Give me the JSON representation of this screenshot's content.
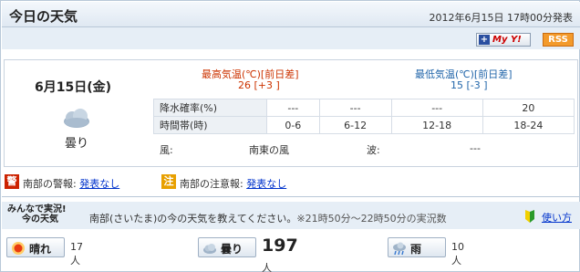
{
  "header": {
    "title": "今日の天気",
    "announced": "2012年6月15日 17時00分発表"
  },
  "toolbar": {
    "my_yahoo_plus": "+",
    "my_yahoo_label": "My Y!",
    "rss_label": "RSS"
  },
  "forecast": {
    "date": "6月15日(金)",
    "condition": "曇り",
    "icon": "cloud-icon",
    "high_label": "最高気温(℃)[前日差]",
    "high_value": "26 [+3 ]",
    "low_label": "最低気温(℃)[前日差]",
    "low_value": "15 [-3 ]",
    "precip_label": "降水確率(%)",
    "precip_values": [
      "---",
      "---",
      "---",
      "20"
    ],
    "period_label": "時間帯(時)",
    "periods": [
      "0-6",
      "6-12",
      "12-18",
      "18-24"
    ],
    "wind_label": "風:",
    "wind_value": "南東の風",
    "wave_label": "波:",
    "wave_value": "---"
  },
  "warnings": {
    "warning_badge": "警",
    "warning_label": "南部の警報:",
    "warning_link": "発表なし",
    "advisory_badge": "注",
    "advisory_label": "南部の注意報:",
    "advisory_link": "発表なし",
    "warning_color": "#cc2200",
    "advisory_color": "#e8a000"
  },
  "poll": {
    "title_line1": "みんなで実況!",
    "title_line2": "今の天気",
    "prompt": "南部(さいたま)の今の天気を教えてください。",
    "period": "※21時50分～22時50分の実況数",
    "howto": "使い方",
    "options": [
      {
        "label": "晴れ",
        "count": "17",
        "unit": "人",
        "icon": "sun-icon"
      },
      {
        "label": "曇り",
        "count": "197",
        "unit": "人",
        "icon": "cloud-icon"
      },
      {
        "label": "雨",
        "count": "10",
        "unit": "人",
        "icon": "rain-icon"
      }
    ]
  }
}
